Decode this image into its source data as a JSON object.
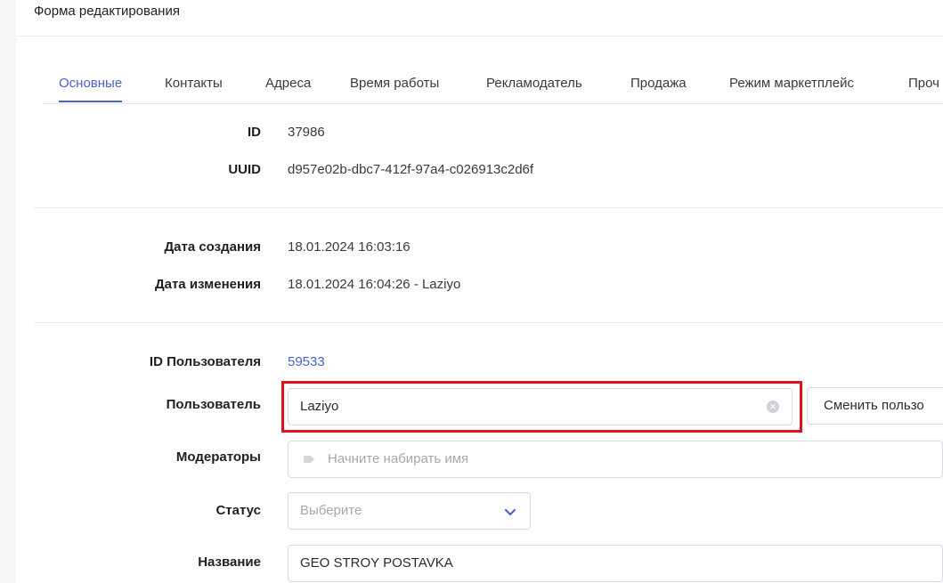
{
  "form": {
    "title": "Форма редактирования"
  },
  "tabs": [
    {
      "label": "Основные",
      "active": true
    },
    {
      "label": "Контакты",
      "active": false
    },
    {
      "label": "Адреса",
      "active": false
    },
    {
      "label": "Время работы",
      "active": false
    },
    {
      "label": "Рекламодатель",
      "active": false
    },
    {
      "label": "Продажа",
      "active": false
    },
    {
      "label": "Режим маркетплейс",
      "active": false
    },
    {
      "label": "Проч",
      "active": false
    }
  ],
  "fields": {
    "id": {
      "label": "ID",
      "value": "37986"
    },
    "uuid": {
      "label": "UUID",
      "value": "d957e02b-dbc7-412f-97a4-c026913c2d6f"
    },
    "created": {
      "label": "Дата создания",
      "value": "18.01.2024 16:03:16"
    },
    "modified": {
      "label": "Дата изменения",
      "value": "18.01.2024 16:04:26 - Laziyo"
    },
    "user_id": {
      "label": "ID Пользователя",
      "value": "59533"
    },
    "user": {
      "label": "Пользователь",
      "value": "Laziyo",
      "button_label": "Сменить пользо"
    },
    "moderators": {
      "label": "Модераторы",
      "placeholder": "Начните набирать имя"
    },
    "status": {
      "label": "Статус",
      "placeholder": "Выберите"
    },
    "name": {
      "label": "Название",
      "value": "GEO STROY POSTAVKA"
    }
  },
  "colors": {
    "accent": "#4a63c5",
    "highlight": "#e3111b"
  },
  "icons": {
    "clear": "clear-icon",
    "tag": "tag-icon",
    "chevron": "chevron-down-icon"
  }
}
